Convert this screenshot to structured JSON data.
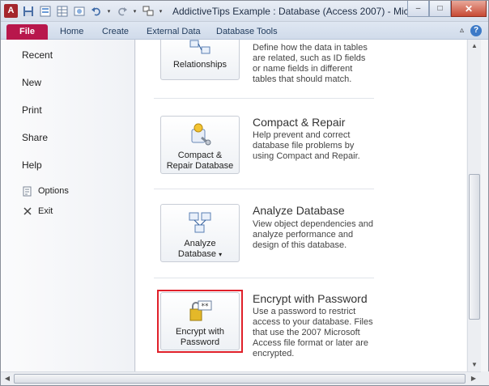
{
  "window": {
    "app_icon_letter": "A",
    "title": "AddictiveTips Example : Database (Access 2007) - Micr...",
    "controls": {
      "minimize": "–",
      "maximize": "□",
      "close": "✕"
    }
  },
  "ribbon": {
    "tabs": [
      {
        "label": "File"
      },
      {
        "label": "Home"
      },
      {
        "label": "Create"
      },
      {
        "label": "External Data"
      },
      {
        "label": "Database Tools"
      }
    ],
    "minimize_ribbon": "▵",
    "help": "?"
  },
  "backstage": {
    "items": [
      {
        "label": "Recent"
      },
      {
        "label": "New"
      },
      {
        "label": "Print"
      },
      {
        "label": "Share"
      },
      {
        "label": "Help"
      }
    ],
    "options_label": "Options",
    "exit_label": "Exit"
  },
  "tools": {
    "relationships": {
      "button_label": "Relationships",
      "description": "Define how the data in tables are related, such as ID fields or name fields in different tables that should match."
    },
    "compact_repair": {
      "title": "Compact & Repair",
      "button_label_1": "Compact &",
      "button_label_2": "Repair Database",
      "description": "Help prevent and correct database file problems by using Compact and Repair."
    },
    "analyze": {
      "title": "Analyze Database",
      "button_label_1": "Analyze",
      "button_label_2": "Database",
      "dropdown_arrow": "▾",
      "description": "View object dependencies and analyze performance and design of this database."
    },
    "encrypt": {
      "title": "Encrypt with Password",
      "button_label_1": "Encrypt with",
      "button_label_2": "Password",
      "description": "Use a password to restrict access to your database. Files that use the 2007 Microsoft Access file format or later are encrypted."
    }
  },
  "colors": {
    "file_tab": "#b8174c",
    "highlight": "#e0202a"
  }
}
